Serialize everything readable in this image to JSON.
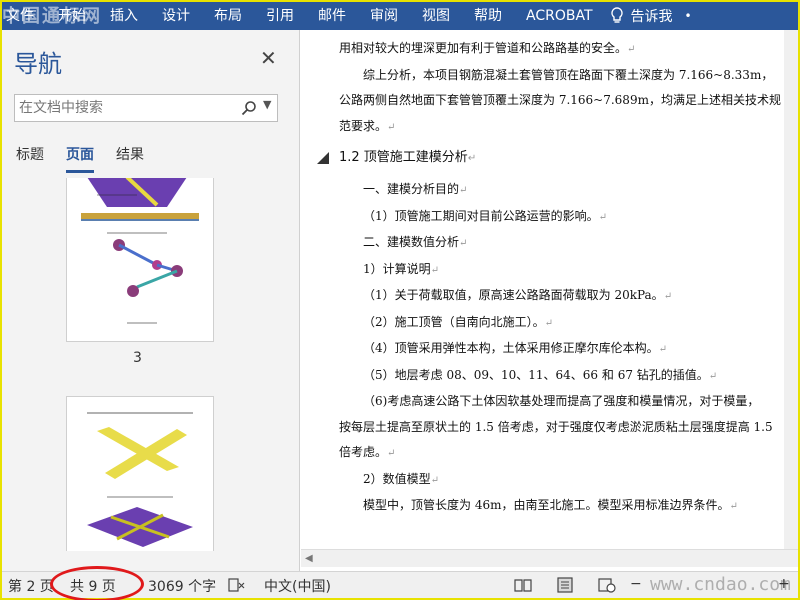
{
  "ribbon": {
    "tabs": [
      "文件",
      "开始",
      "插入",
      "设计",
      "布局",
      "引用",
      "邮件",
      "审阅",
      "视图",
      "帮助",
      "ACROBAT"
    ],
    "tell_me": "告诉我",
    "watermark": "中国通标网"
  },
  "nav": {
    "title": "导航",
    "search_placeholder": "在文档中搜索",
    "tabs": [
      "标题",
      "页面",
      "结果"
    ],
    "active_tab": "页面",
    "thumbnail_page_number": "3"
  },
  "document": {
    "paragraphs": [
      "用相对较大的埋深更加有利于管道和公路路基的安全。",
      "综上分析，本项目钢筋混凝土套管管顶在路面下覆土深度为 7.166~8.33m，",
      "公路两侧自然地面下套管管顶覆土深度为 7.166~7.689m，均满足上述相关技术规",
      "范要求。"
    ],
    "heading": "1.2 顶管施工建模分析",
    "items": [
      "一、建模分析目的",
      "（1）顶管施工期间对目前公路运营的影响。",
      "二、建模数值分析",
      "1）计算说明",
      "（1）关于荷载取值，原高速公路路面荷载取为 20kPa。",
      "（2）施工顶管（自南向北施工）。",
      "（4）顶管采用弹性本构，土体采用修正摩尔库伦本构。",
      "（5）地层考虑 08、09、10、11、64、66 和 67 钻孔的插值。"
    ],
    "para6_line1": "（6)考虑高速公路下土体因软基处理而提高了强度和模量情况，对于模量，",
    "para6_line2": "按每层土提高至原状土的 1.5 倍考虑，对于强度仅考虑淤泥质粘土层强度提高 1.5",
    "para6_line3": "倍考虑。",
    "sub_heading": "2）数值模型",
    "model_text": "模型中，顶管长度为 46m，由南至北施工。模型采用标准边界条件。",
    "paragraph_mark": "↵"
  },
  "status_bar": {
    "page": "第 2 页",
    "total_pages": "共 9 页",
    "word_count": "3069 个字",
    "language": "中文(中国)",
    "watermark": "www.cndao.com"
  },
  "colors": {
    "ribbon": "#2b579a",
    "accent": "#2b579a",
    "highlight": "#e0191b"
  }
}
